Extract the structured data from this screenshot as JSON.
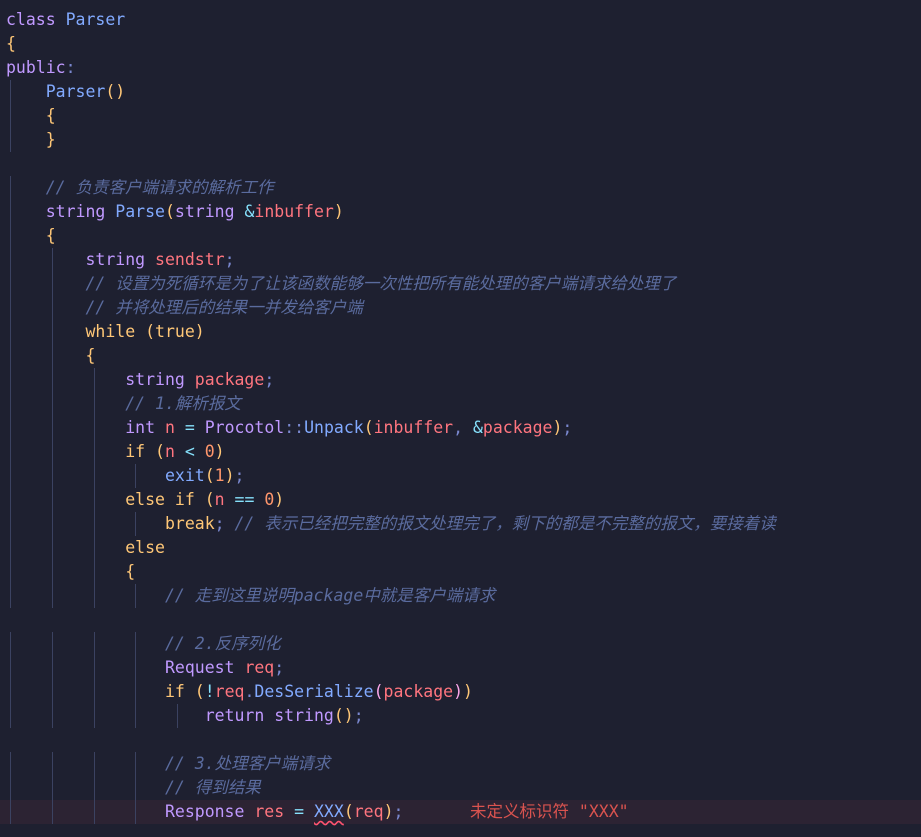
{
  "editor": {
    "language": "C++",
    "theme_colors": {
      "background": "#1e2030",
      "keyword": "#c099ff",
      "control": "#ffc777",
      "function": "#82aaff",
      "variable": "#ff757f",
      "number": "#ff966c",
      "comment": "#5a6b9e",
      "error": "#d9534f"
    },
    "lines": [
      "class Parser",
      "{",
      "public:",
      "    Parser()",
      "    {",
      "    }",
      "",
      "    // 负责客户端请求的解析工作",
      "    string Parse(string &inbuffer)",
      "    {",
      "        string sendstr;",
      "        // 设置为死循环是为了让该函数能够一次性把所有能处理的客户端请求给处理了",
      "        // 并将处理后的结果一并发给客户端",
      "        while (true)",
      "        {",
      "            string package;",
      "            // 1.解析报文",
      "            int n = Procotol::Unpack(inbuffer, &package);",
      "            if (n < 0)",
      "                exit(1);",
      "            else if (n == 0)",
      "                break; // 表示已经把完整的报文处理完了，剩下的都是不完整的报文，要接着读",
      "            else",
      "            {",
      "                // 走到这里说明package中就是客户端请求",
      "",
      "                // 2.反序列化",
      "                Request req;",
      "                if (!req.DesSerialize(package))",
      "                    return string();",
      "",
      "                // 3.处理客户端请求",
      "                // 得到结果",
      "                Response res = XXX(req);"
    ],
    "error_line_index": 33,
    "error_message": "未定义标识符 \"XXX\""
  }
}
